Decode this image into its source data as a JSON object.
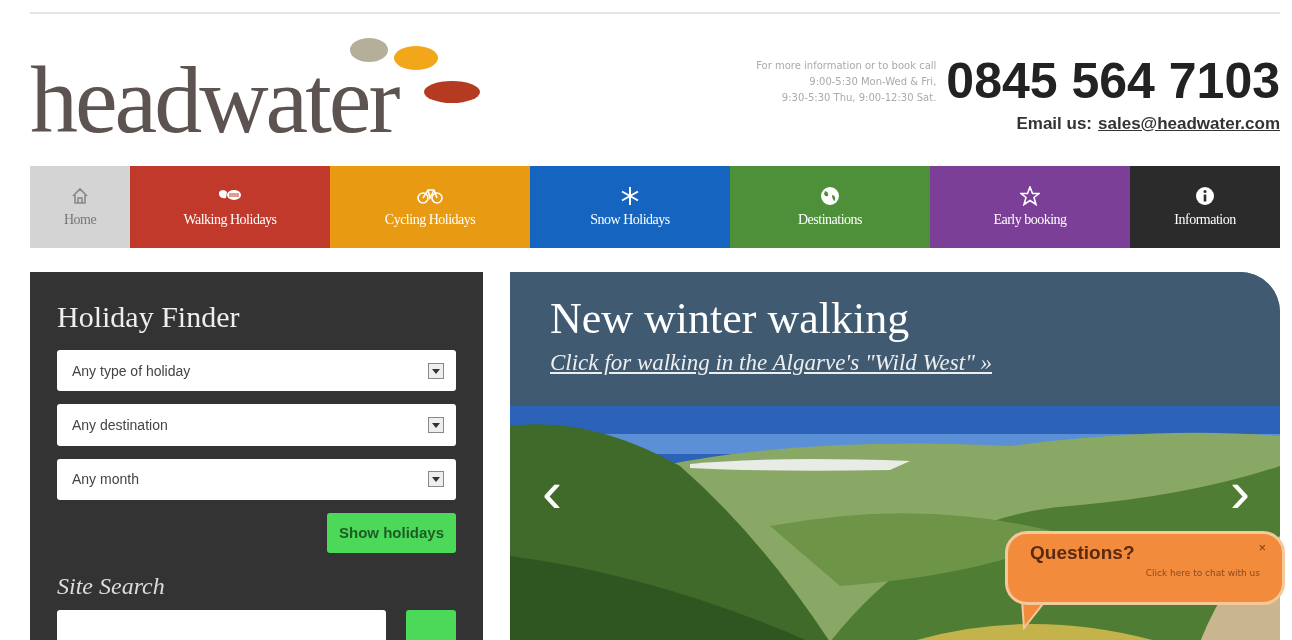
{
  "header": {
    "logo": "headwater",
    "booking_info": [
      "For more information or to book call",
      "9:00-5:30 Mon-Wed & Fri,",
      "9:30-5:30 Thu, 9:00-12:30 Sat."
    ],
    "phone": "0845 564 7103",
    "email_label": "Email us:",
    "email": "sales@headwater.com"
  },
  "nav": [
    {
      "label": "Home",
      "kind": "home",
      "color": "#d4d4d4"
    },
    {
      "label": "Walking Holidays",
      "kind": "boots",
      "color": "#c0392b"
    },
    {
      "label": "Cycling Holidays",
      "kind": "bike",
      "color": "#e89a12"
    },
    {
      "label": "Snow Holidays",
      "kind": "snow",
      "color": "#1565c0"
    },
    {
      "label": "Destinations",
      "kind": "globe",
      "color": "#4e8f3a"
    },
    {
      "label": "Early booking",
      "kind": "star",
      "color": "#7b3f98"
    },
    {
      "label": "Information",
      "kind": "info",
      "color": "#2b2b2b"
    }
  ],
  "finder": {
    "title": "Holiday Finder",
    "selects": [
      "Any type of holiday",
      "Any destination",
      "Any month"
    ],
    "button": "Show holidays",
    "search_title": "Site Search"
  },
  "slider": {
    "title": "New winter walking",
    "link": "Click for walking in the Algarve's \"Wild West\" »",
    "prev": "‹",
    "next": "›"
  },
  "chat": {
    "title": "Questions?",
    "subtitle": "Click here to chat with us",
    "close": "×"
  }
}
